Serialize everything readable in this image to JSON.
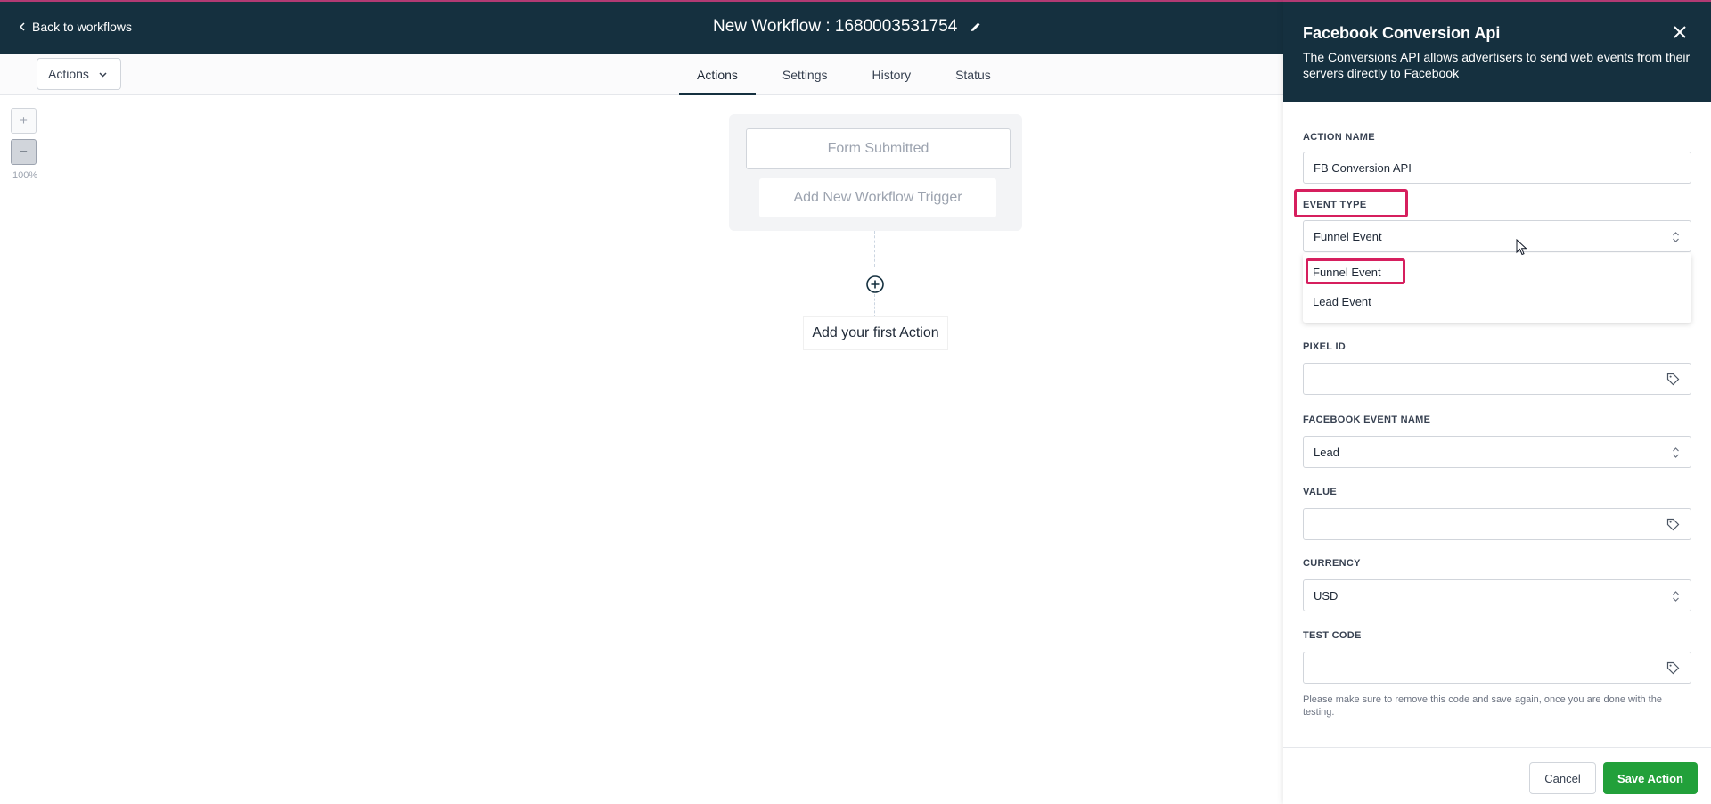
{
  "header": {
    "back_label": "Back to workflows",
    "title": "New Workflow : 1680003531754"
  },
  "toolbar": {
    "actions_label": "Actions"
  },
  "tabs": [
    {
      "label": "Actions",
      "active": true
    },
    {
      "label": "Settings",
      "active": false
    },
    {
      "label": "History",
      "active": false
    },
    {
      "label": "Status",
      "active": false
    }
  ],
  "zoom": {
    "in_label": "+",
    "out_label": "−",
    "level": "100%"
  },
  "canvas": {
    "trigger_label": "Form Submitted",
    "add_trigger_label": "Add New Workflow Trigger",
    "first_action_label": "Add your first Action"
  },
  "panel": {
    "title": "Facebook Conversion Api",
    "description": "The Conversions API allows advertisers to send web events from their servers directly to Facebook",
    "fields": {
      "action_name": {
        "label": "ACTION NAME",
        "value": "FB Conversion API"
      },
      "event_type": {
        "label": "EVENT TYPE",
        "value": "Funnel Event",
        "options": [
          "Funnel Event",
          "Lead Event"
        ]
      },
      "pixel_id": {
        "label": "PIXEL ID",
        "value": ""
      },
      "facebook_event_name": {
        "label": "FACEBOOK EVENT NAME",
        "value": "Lead"
      },
      "value": {
        "label": "VALUE",
        "value": ""
      },
      "currency": {
        "label": "CURRENCY",
        "value": "USD"
      },
      "test_code": {
        "label": "TEST CODE",
        "value": ""
      }
    },
    "help_text": "Please make sure to remove this code and save again, once you are done with the testing.",
    "cancel_label": "Cancel",
    "save_label": "Save Action"
  },
  "colors": {
    "header_bg": "#15303f",
    "accent_border": "#b23a73",
    "highlight": "#d61f5e",
    "save_button": "#22a03a"
  }
}
